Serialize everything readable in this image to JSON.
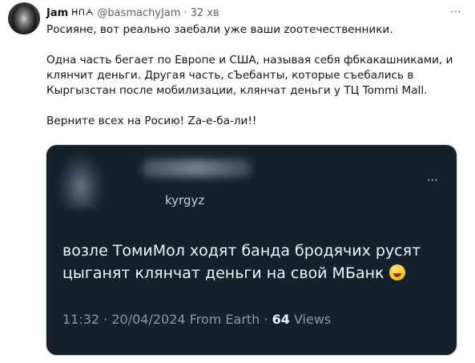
{
  "tweet": {
    "author_name": "Jam",
    "author_name_decoration": "ᕼᑎᗅ",
    "handle": "@basmachyJam",
    "separator": "·",
    "time": "32 хв",
    "more_icon": "⋯",
    "paragraphs": [
      "Росияне, вот реально заебали уже ваши zоотечественники.",
      "Одна часть бегает по Европе и США, называя себя фбкакашниками, и",
      "клянчит деньги. Другая часть, сЪебанты, которые съебались в",
      "Кыргызстан после мобилизации, клянчат деньги у ТЦ Tommi Mall.",
      "Верните всех на Росию! Zа-е-ба-ли!!"
    ]
  },
  "quoted": {
    "handle": "kyrgyz",
    "more_icon": "⋯",
    "line1": "возле ТомиМол ходят банда бродячих русят",
    "line2": "цыганят клянчат деньги на свой МБанк",
    "emoji_name": "rolling-on-floor-laughing-emoji",
    "meta_prefix": "11:32 · 20/04/2024 From Earth ·",
    "views_count": "64",
    "views_label": "Views"
  }
}
